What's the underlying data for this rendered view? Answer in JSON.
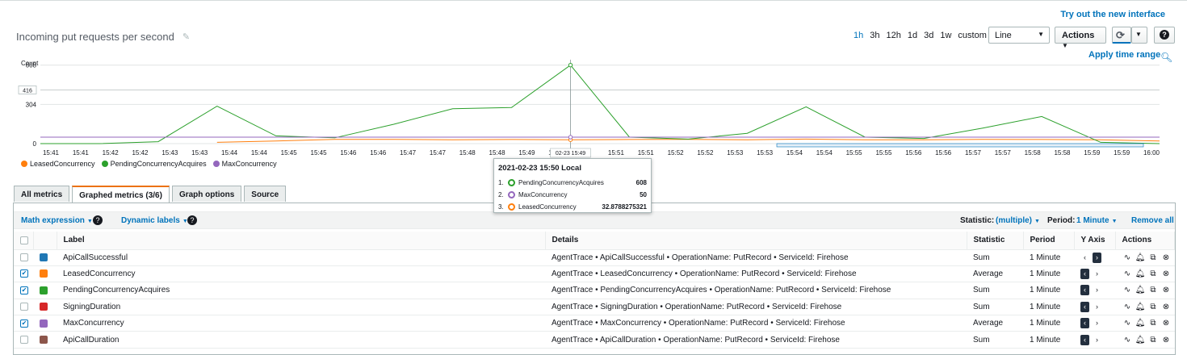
{
  "header": {
    "try_link": "Try out the new interface",
    "title": "Incoming put requests per second",
    "time_ranges": [
      "1h",
      "3h",
      "12h",
      "1d",
      "3d",
      "1w",
      "custom"
    ],
    "active_range": "1h",
    "chart_type_select": "Line",
    "actions_label": "Actions",
    "apply_time_range": "Apply time range",
    "help_label": "?"
  },
  "chart_data": {
    "type": "line",
    "ylabel": "Count",
    "y_ticks": [
      0,
      304,
      608
    ],
    "y_marker": "416",
    "ylim": [
      0,
      650
    ],
    "x_tick_labels": [
      "15:41",
      "15:41",
      "15:42",
      "15:42",
      "15:43",
      "15:43",
      "15:44",
      "15:44",
      "15:45",
      "15:45",
      "15:46",
      "15:46",
      "15:47",
      "15:47",
      "15:48",
      "15:48",
      "15:49",
      "15:49",
      "15:50",
      "15:51",
      "15:51",
      "15:52",
      "15:52",
      "15:53",
      "15:53",
      "15:54",
      "15:54",
      "15:55",
      "15:55",
      "15:56",
      "15:56",
      "15:57",
      "15:57",
      "15:58",
      "15:58",
      "15:59",
      "15:59",
      "16:00"
    ],
    "cursor_label": "02-23 15:49",
    "x_minutes": [
      0,
      1,
      2,
      3,
      4,
      5,
      6,
      7,
      8,
      9,
      10,
      11,
      12,
      13,
      14,
      15,
      16,
      17,
      18,
      19
    ],
    "series": [
      {
        "name": "LeasedConcurrency",
        "color": "#ff7f0e",
        "values": [
          null,
          null,
          null,
          10,
          20,
          33,
          33,
          30,
          32,
          30,
          32,
          33,
          30,
          35,
          30,
          30,
          33,
          32,
          30,
          20
        ]
      },
      {
        "name": "PendingConcurrencyAcquires",
        "color": "#2ca02c",
        "values": [
          0,
          0,
          15,
          290,
          60,
          45,
          150,
          270,
          280,
          608,
          50,
          35,
          80,
          285,
          50,
          40,
          120,
          210,
          10,
          0
        ]
      },
      {
        "name": "MaxConcurrency",
        "color": "#9467bd",
        "values": [
          50,
          50,
          50,
          50,
          50,
          50,
          50,
          50,
          50,
          50,
          50,
          50,
          50,
          50,
          50,
          50,
          50,
          50,
          50,
          50
        ]
      }
    ],
    "legend": [
      "LeasedConcurrency",
      "PendingConcurrencyAcquires",
      "MaxConcurrency"
    ]
  },
  "tooltip": {
    "title": "2021-02-23 15:50 Local",
    "rows": [
      {
        "n": "1.",
        "label": "PendingConcurrencyAcquires",
        "value": "608",
        "color": "#2ca02c"
      },
      {
        "n": "2.",
        "label": "MaxConcurrency",
        "value": "50",
        "color": "#9467bd"
      },
      {
        "n": "3.",
        "label": "LeasedConcurrency",
        "value": "32.8788275321",
        "color": "#ff7f0e"
      }
    ]
  },
  "tabs": [
    "All metrics",
    "Graphed metrics (3/6)",
    "Graph options",
    "Source"
  ],
  "toolbar": {
    "math_expression": "Math expression",
    "dynamic_labels": "Dynamic labels",
    "statistic_label": "Statistic:",
    "statistic_value": "(multiple)",
    "period_label": "Period:",
    "period_value": "1 Minute",
    "remove_all": "Remove all"
  },
  "table": {
    "headers": [
      "Label",
      "Details",
      "Statistic",
      "Period",
      "Y Axis",
      "Actions"
    ],
    "rows": [
      {
        "checked": false,
        "color": "#1f77b4",
        "label": "ApiCallSuccessful",
        "details": "AgentTrace • ApiCallSuccessful • OperationName: PutRecord • ServiceId: Firehose",
        "statistic": "Sum",
        "period": "1 Minute",
        "yaxis": "right"
      },
      {
        "checked": true,
        "color": "#ff7f0e",
        "label": "LeasedConcurrency",
        "details": "AgentTrace • LeasedConcurrency • OperationName: PutRecord • ServiceId: Firehose",
        "statistic": "Average",
        "period": "1 Minute",
        "yaxis": "left"
      },
      {
        "checked": true,
        "color": "#2ca02c",
        "label": "PendingConcurrencyAcquires",
        "details": "AgentTrace • PendingConcurrencyAcquires • OperationName: PutRecord • ServiceId: Firehose",
        "statistic": "Sum",
        "period": "1 Minute",
        "yaxis": "left"
      },
      {
        "checked": false,
        "color": "#d62728",
        "label": "SigningDuration",
        "details": "AgentTrace • SigningDuration • OperationName: PutRecord • ServiceId: Firehose",
        "statistic": "Sum",
        "period": "1 Minute",
        "yaxis": "left"
      },
      {
        "checked": true,
        "color": "#9467bd",
        "label": "MaxConcurrency",
        "details": "AgentTrace • MaxConcurrency • OperationName: PutRecord • ServiceId: Firehose",
        "statistic": "Average",
        "period": "1 Minute",
        "yaxis": "left"
      },
      {
        "checked": false,
        "color": "#8c564b",
        "label": "ApiCallDuration",
        "details": "AgentTrace • ApiCallDuration • OperationName: PutRecord • ServiceId: Firehose",
        "statistic": "Sum",
        "period": "1 Minute",
        "yaxis": "left"
      }
    ]
  }
}
